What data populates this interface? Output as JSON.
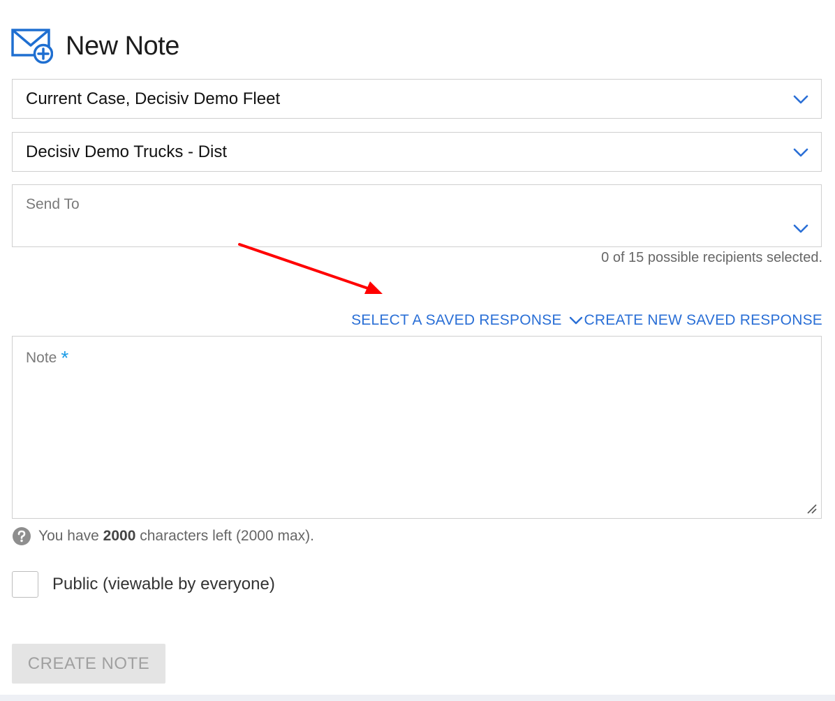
{
  "header": {
    "title": "New Note"
  },
  "form": {
    "case_select": {
      "value": "Current Case, Decisiv Demo Fleet"
    },
    "location_select": {
      "value": "Decisiv Demo Trucks - Dist"
    },
    "send_to": {
      "placeholder": "Send To"
    },
    "recipients_count": "0 of 15 possible recipients selected.",
    "saved_response": {
      "select_label": "SELECT A SAVED RESPONSE",
      "create_label": "CREATE NEW SAVED RESPONSE"
    },
    "note": {
      "placeholder": "Note",
      "required_marker": "*"
    },
    "chars_left": {
      "prefix": "You have",
      "count": "2000",
      "suffix": "characters left (2000 max)."
    },
    "public_checkbox": {
      "label": "Public (viewable by everyone)",
      "checked": false
    },
    "submit_label": "CREATE NOTE"
  },
  "colors": {
    "accent": "#2a6fd6",
    "required": "#1a9be6",
    "annotation_arrow": "#ff0000",
    "disabled_button_bg": "#e4e4e4"
  },
  "icons": {
    "header": "mail-add-icon",
    "dropdown": "chevron-down-icon",
    "help": "question-circle-icon",
    "resize": "resize-handle-icon"
  }
}
